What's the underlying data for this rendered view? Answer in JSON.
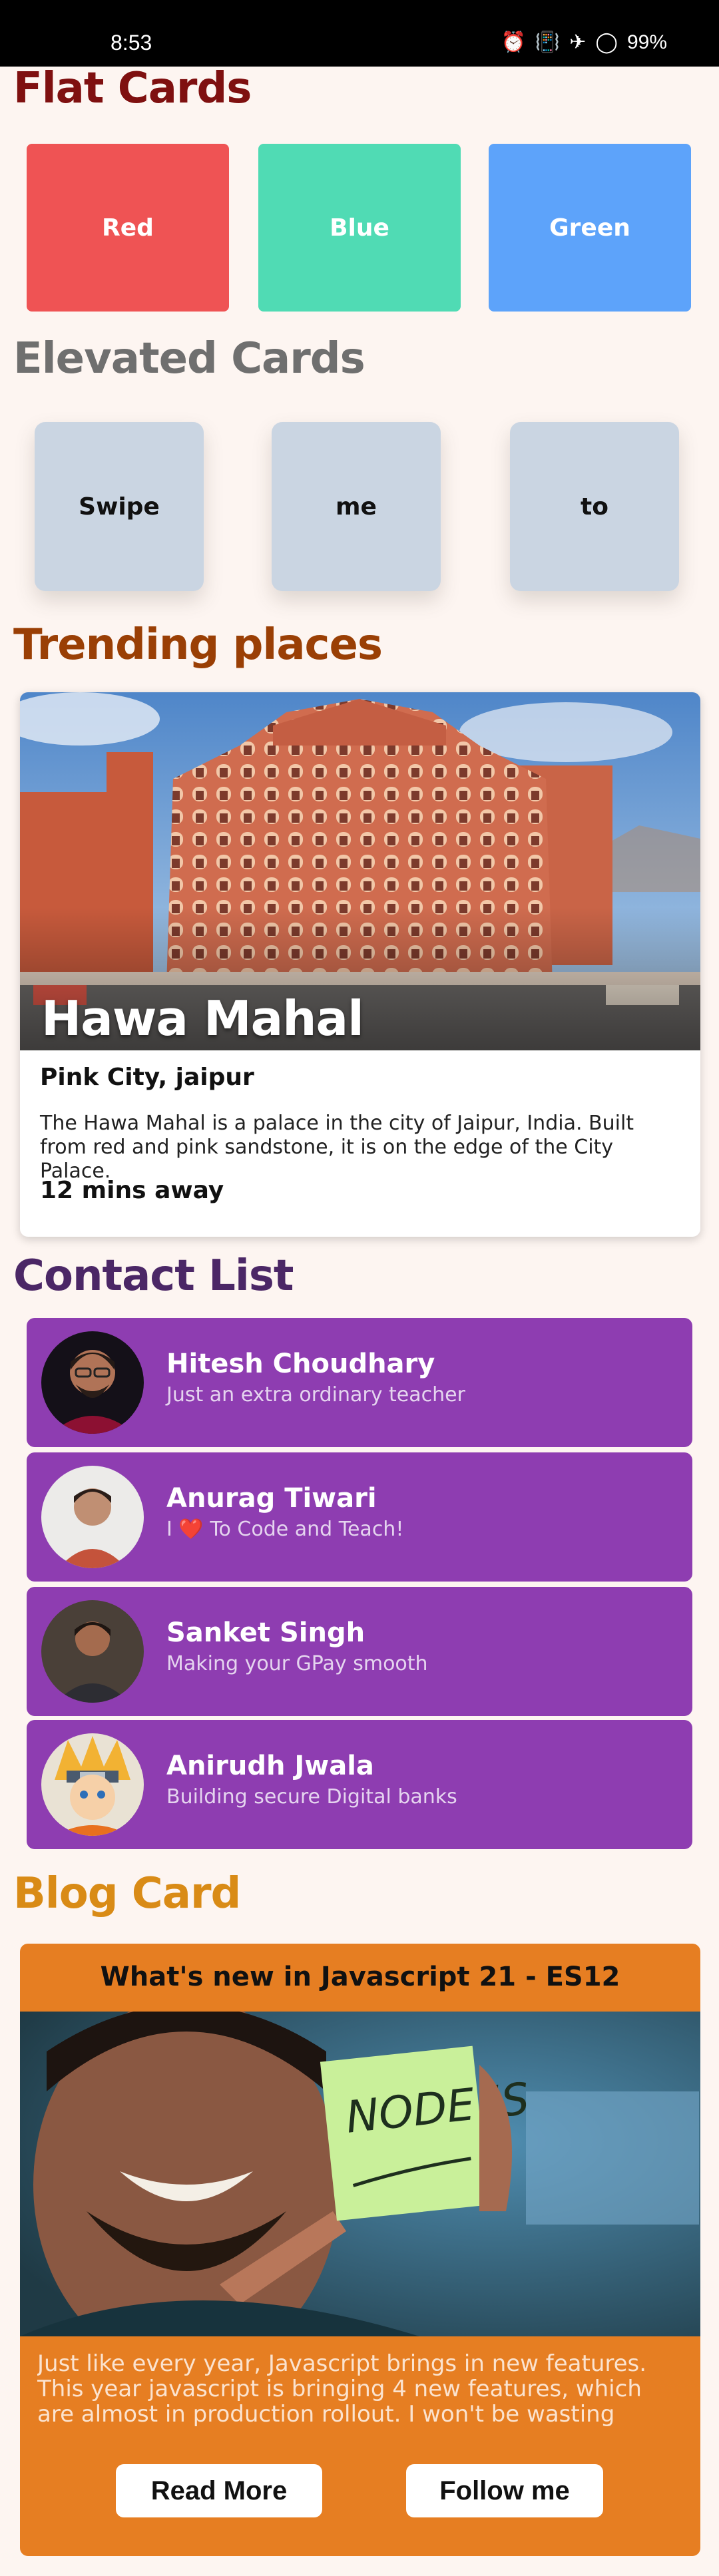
{
  "status_bar": {
    "time": "8:53",
    "icons": [
      "alarm-icon",
      "vibrate-icon",
      "airplane-icon",
      "battery-icon"
    ],
    "battery": "99%"
  },
  "sections": {
    "flat": "Flat Cards",
    "elevated": "Elevated Cards",
    "trending": "Trending places",
    "contacts": "Contact List",
    "blog": "Blog Card"
  },
  "flat_cards": [
    {
      "label": "Red",
      "color": "#ef5354"
    },
    {
      "label": "Blue",
      "color": "#50dbb4"
    },
    {
      "label": "Green",
      "color": "#5da3fa"
    }
  ],
  "elevated_cards": [
    {
      "label": "Swipe"
    },
    {
      "label": "me"
    },
    {
      "label": "to"
    }
  ],
  "trending": {
    "name": "Hawa Mahal",
    "label": "Pink City, jaipur",
    "description": "The Hawa Mahal is a palace in the city of Jaipur, India. Built from red and pink sandstone, it is on the edge of the City Palace.",
    "footer": "12 mins away"
  },
  "contacts": [
    {
      "name": "Hitesh Choudhary",
      "status": "Just an extra ordinary teacher"
    },
    {
      "name": "Anurag Tiwari",
      "status_prefix": "I",
      "status_heart": "❤️",
      "status_suffix": "To Code and Teach!"
    },
    {
      "name": "Sanket Singh",
      "status": "Making your GPay smooth"
    },
    {
      "name": "Anirudh Jwala",
      "status": "Building secure Digital banks"
    }
  ],
  "blog": {
    "title": "What's new in Javascript 21 - ES12",
    "image_note": "NODE JS",
    "body": "Just like every year, Javascript brings in new features. This year javascript is bringing 4 new features, which are almost in production rollout. I won't be wasting much mo…",
    "read_more": "Read More",
    "follow": "Follow me"
  },
  "colors": {
    "background": "#fdf5f1",
    "contact_card": "#8e3db1",
    "blog_card": "#e67e22"
  }
}
